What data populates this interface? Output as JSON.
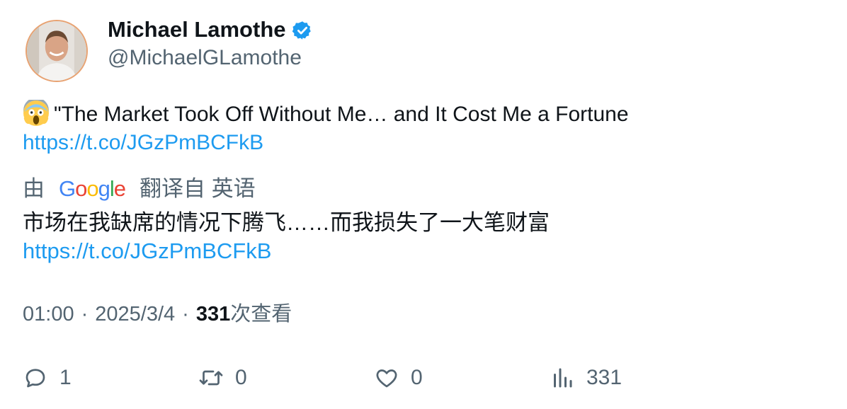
{
  "author": {
    "display_name": "Michael Lamothe",
    "handle": "@MichaelGLamothe",
    "verified": true,
    "verified_color": "#1d9bf0"
  },
  "tweet": {
    "emoji": "face-screaming-in-fear",
    "text": "\"The Market Took Off Without Me… and It Cost Me a Fortune",
    "link": "https://t.co/JGzPmBCFkB"
  },
  "translation": {
    "prefix": "由",
    "provider": "Google",
    "suffix": "翻译自 英语",
    "text": "市场在我缺席的情况下腾飞……而我损失了一大笔财富",
    "link": "https://t.co/JGzPmBCFkB"
  },
  "meta": {
    "time": "01:00",
    "separator": "·",
    "date": "2025/3/4",
    "views_count": "331",
    "views_label": "次查看"
  },
  "actions": {
    "reply_count": "1",
    "retweet_count": "0",
    "like_count": "0",
    "views_count": "331"
  },
  "colors": {
    "link": "#1d9bf0",
    "secondary_text": "#536471",
    "primary_text": "#0f1419"
  }
}
